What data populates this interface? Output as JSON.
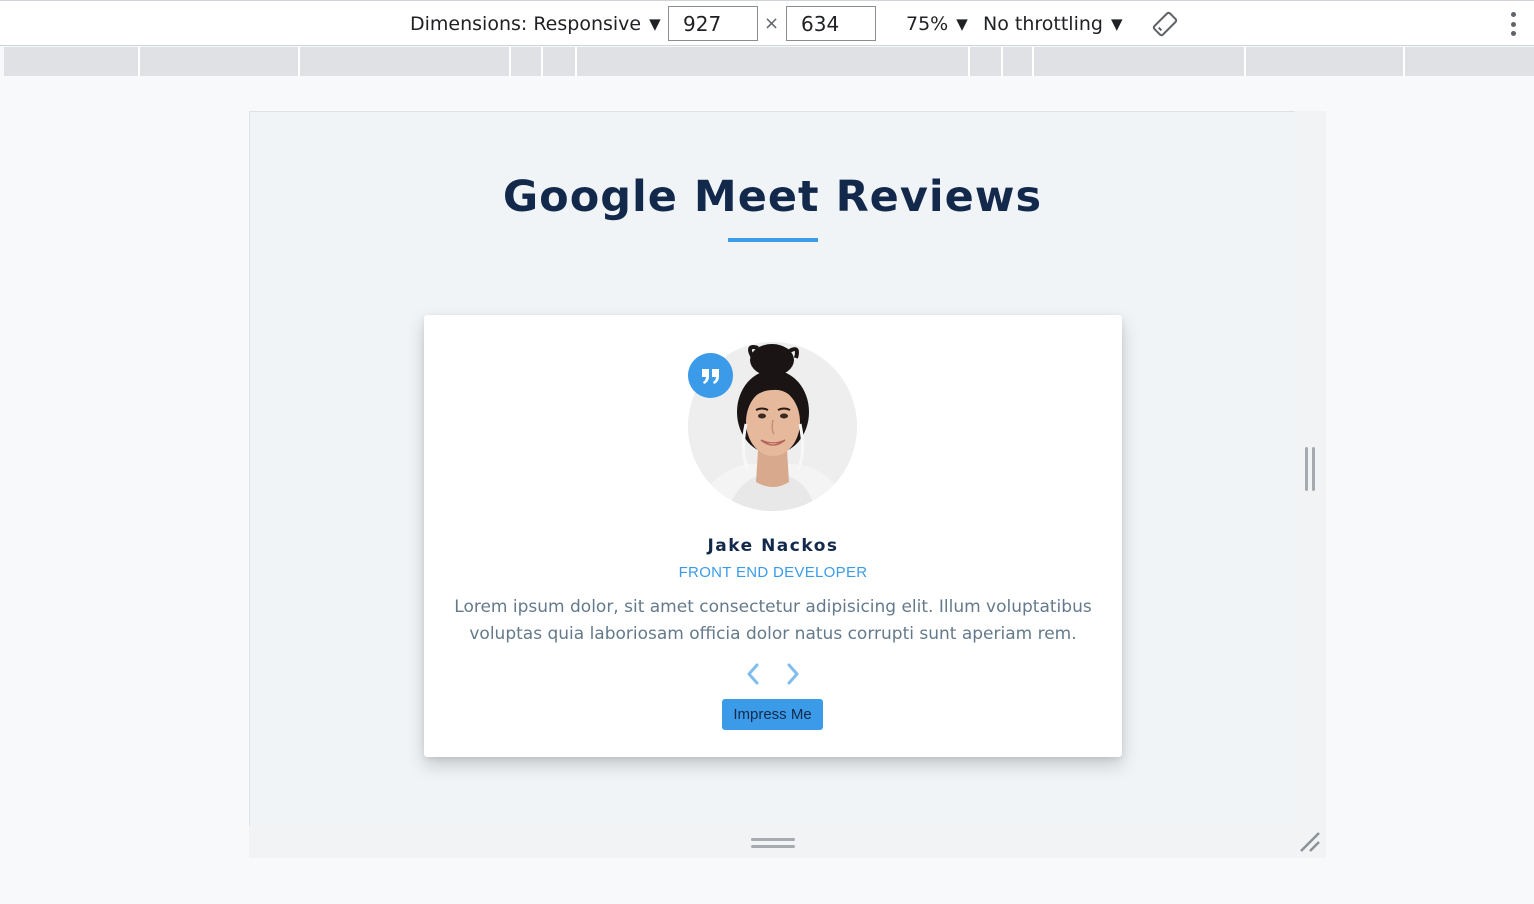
{
  "devtools": {
    "dimensions_label": "Dimensions: Responsive",
    "width_value": "927",
    "height_value": "634",
    "times_symbol": "×",
    "zoom_label": "75%",
    "throttling_label": "No throttling",
    "caret": "▼"
  },
  "page": {
    "title": "Google Meet Reviews"
  },
  "review": {
    "name": "Jake Nackos",
    "job": "FRONT END DEVELOPER",
    "text": "Lorem ipsum dolor, sit amet consectetur adipisicing elit. Illum voluptatibus voluptas quia laboriosam officia dolor natus corrupti sunt aperiam rem.",
    "button_label": "Impress Me"
  },
  "colors": {
    "accent": "#3b9be8",
    "title": "#13294b",
    "text": "#647a8c",
    "page_bg": "#f1f4f7"
  },
  "icons": {
    "quote": "quote-icon",
    "prev": "chevron-left-icon",
    "next": "chevron-right-icon",
    "rotate": "rotate-icon",
    "menu": "more-vert-icon"
  }
}
